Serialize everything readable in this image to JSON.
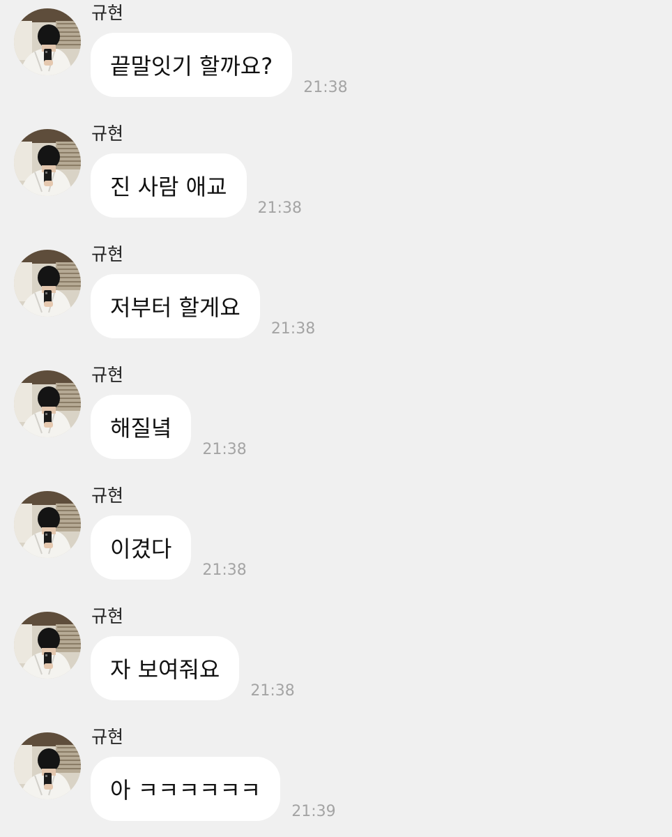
{
  "messages": [
    {
      "sender": "규현",
      "text": "끝말잇기 할까요?",
      "time": "21:38"
    },
    {
      "sender": "규현",
      "text": "진 사람 애교",
      "time": "21:38"
    },
    {
      "sender": "규현",
      "text": "저부터 할게요",
      "time": "21:38"
    },
    {
      "sender": "규현",
      "text": "해질녘",
      "time": "21:38"
    },
    {
      "sender": "규현",
      "text": "이겼다",
      "time": "21:38"
    },
    {
      "sender": "규현",
      "text": "자 보여줘요",
      "time": "21:38"
    },
    {
      "sender": "규현",
      "text": "아 ㅋㅋㅋㅋㅋㅋ",
      "time": "21:39"
    }
  ],
  "colors": {
    "background": "#f0f0f0",
    "bubble": "#ffffff",
    "timestamp": "#a4a4a4",
    "text": "#111111"
  }
}
